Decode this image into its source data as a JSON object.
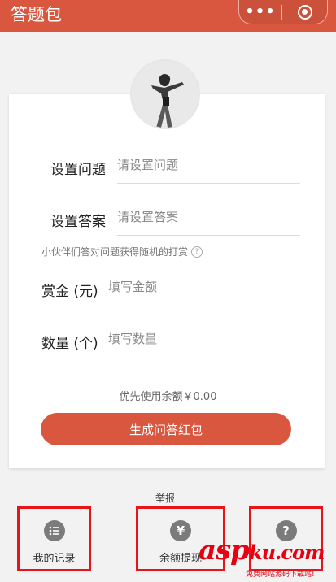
{
  "header": {
    "title": "答题包",
    "more_icon": "•••"
  },
  "form": {
    "question_label": "设置问题",
    "question_placeholder": "请设置问题",
    "answer_label": "设置答案",
    "answer_placeholder": "请设置答案",
    "hint": "小伙伴们答对问题获得随机的打赏",
    "reward_label": "赏金 (元)",
    "reward_placeholder": "填写金额",
    "quantity_label": "数量 (个)",
    "quantity_placeholder": "填写数量",
    "balance_text": "优先使用余额￥0.00",
    "submit_label": "生成问答红包"
  },
  "report_label": "举报",
  "tabs": [
    {
      "label": "我的记录",
      "icon": "list-icon"
    },
    {
      "label": "余额提现",
      "icon": "yen-icon"
    },
    {
      "label": "",
      "icon": "question-icon"
    }
  ],
  "watermark": {
    "main": "asp",
    "suffix": "ku",
    "tld": ".com",
    "sub": "免费网站源码下载站!"
  },
  "colors": {
    "brand": "#d9573f",
    "highlight": "#e8141a",
    "icon_gray": "#7b7b7b"
  }
}
